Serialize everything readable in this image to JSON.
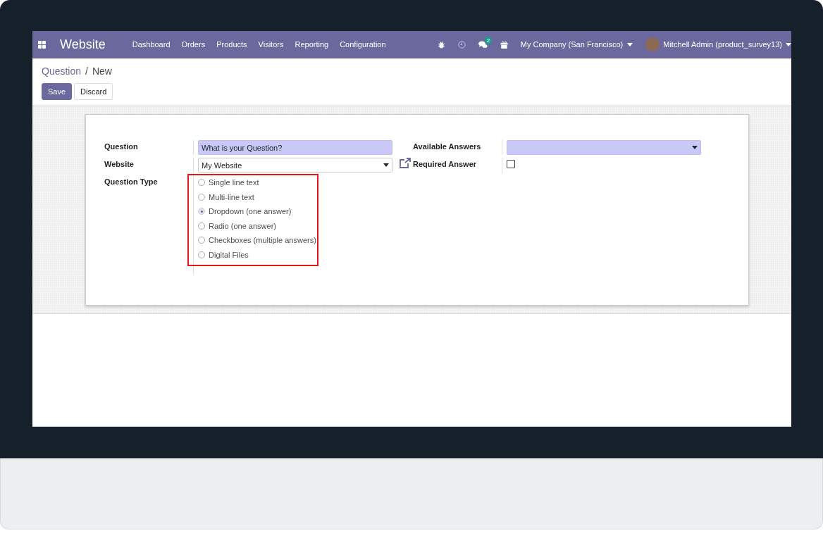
{
  "navbar": {
    "app_name": "Website",
    "menu": [
      "Dashboard",
      "Orders",
      "Products",
      "Visitors",
      "Reporting",
      "Configuration"
    ],
    "messages_badge": "2",
    "company": "My Company (San Francisco)",
    "user": "Mitchell Admin (product_survey13)"
  },
  "breadcrumb": {
    "parent": "Question",
    "separator": "/",
    "current": "New"
  },
  "buttons": [
    {
      "label": "Save",
      "kind": "primary"
    },
    {
      "label": "Discard",
      "kind": "secondary"
    }
  ],
  "form": {
    "question": {
      "label": "Question",
      "value": "What is your Question?"
    },
    "website": {
      "label": "Website",
      "value": "My Website"
    },
    "question_type": {
      "label": "Question Type",
      "options": [
        {
          "label": "Single line text",
          "selected": false
        },
        {
          "label": "Multi-line text",
          "selected": false
        },
        {
          "label": "Dropdown (one answer)",
          "selected": true
        },
        {
          "label": "Radio (one answer)",
          "selected": false
        },
        {
          "label": "Checkboxes (multiple answers)",
          "selected": false
        },
        {
          "label": "Digital Files",
          "selected": false
        }
      ]
    },
    "available_answers": {
      "label": "Available Answers"
    },
    "required_answer": {
      "label": "Required Answer",
      "checked": false
    }
  }
}
